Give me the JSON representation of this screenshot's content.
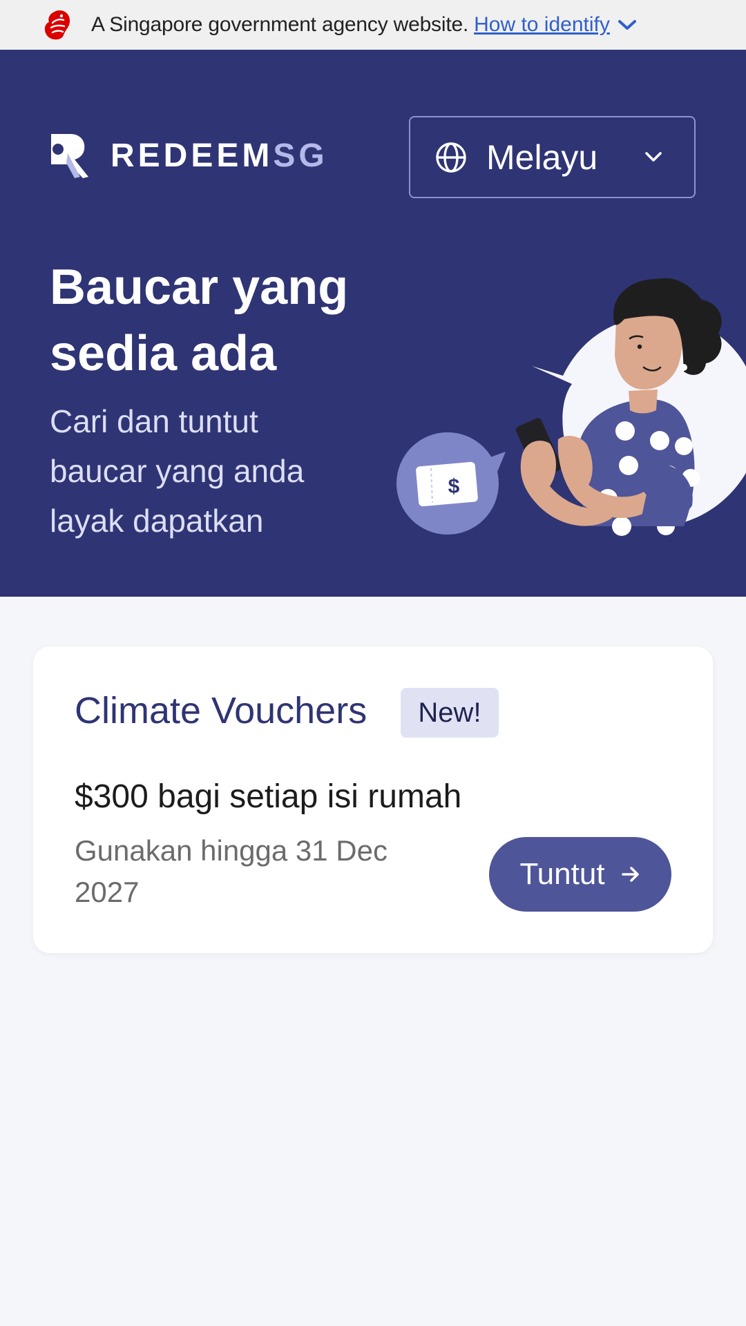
{
  "masthead": {
    "text": "A Singapore government agency website.",
    "link": "How to identify",
    "lion_icon": "merlion-lion-icon",
    "chevron_icon": "chevron-down-icon"
  },
  "header": {
    "brand_primary": "REDEEM",
    "brand_secondary": "SG",
    "language": {
      "selected": "Melayu",
      "icon": "globe-icon",
      "chevron_icon": "chevron-down-icon"
    }
  },
  "hero": {
    "title_line1": "Baucar yang",
    "title_line2": "sedia ada",
    "subtitle": "Cari dan tuntut baucar yang anda layak dapatkan",
    "voucher_symbol": "$"
  },
  "vouchers": [
    {
      "title": "Climate Vouchers",
      "badge": "New!",
      "amount": "$300 bagi setiap isi rumah",
      "expiry": "Gunakan hingga 31 Dec 2027",
      "action_label": "Tuntut",
      "action_icon": "arrow-right-icon"
    }
  ],
  "colors": {
    "hero_bg": "#2f3474",
    "accent": "#4e5599",
    "badge_bg": "#e0e2f4",
    "page_bg": "#f5f6fa",
    "link": "#2f5fcc",
    "lion_red": "#db0000"
  }
}
